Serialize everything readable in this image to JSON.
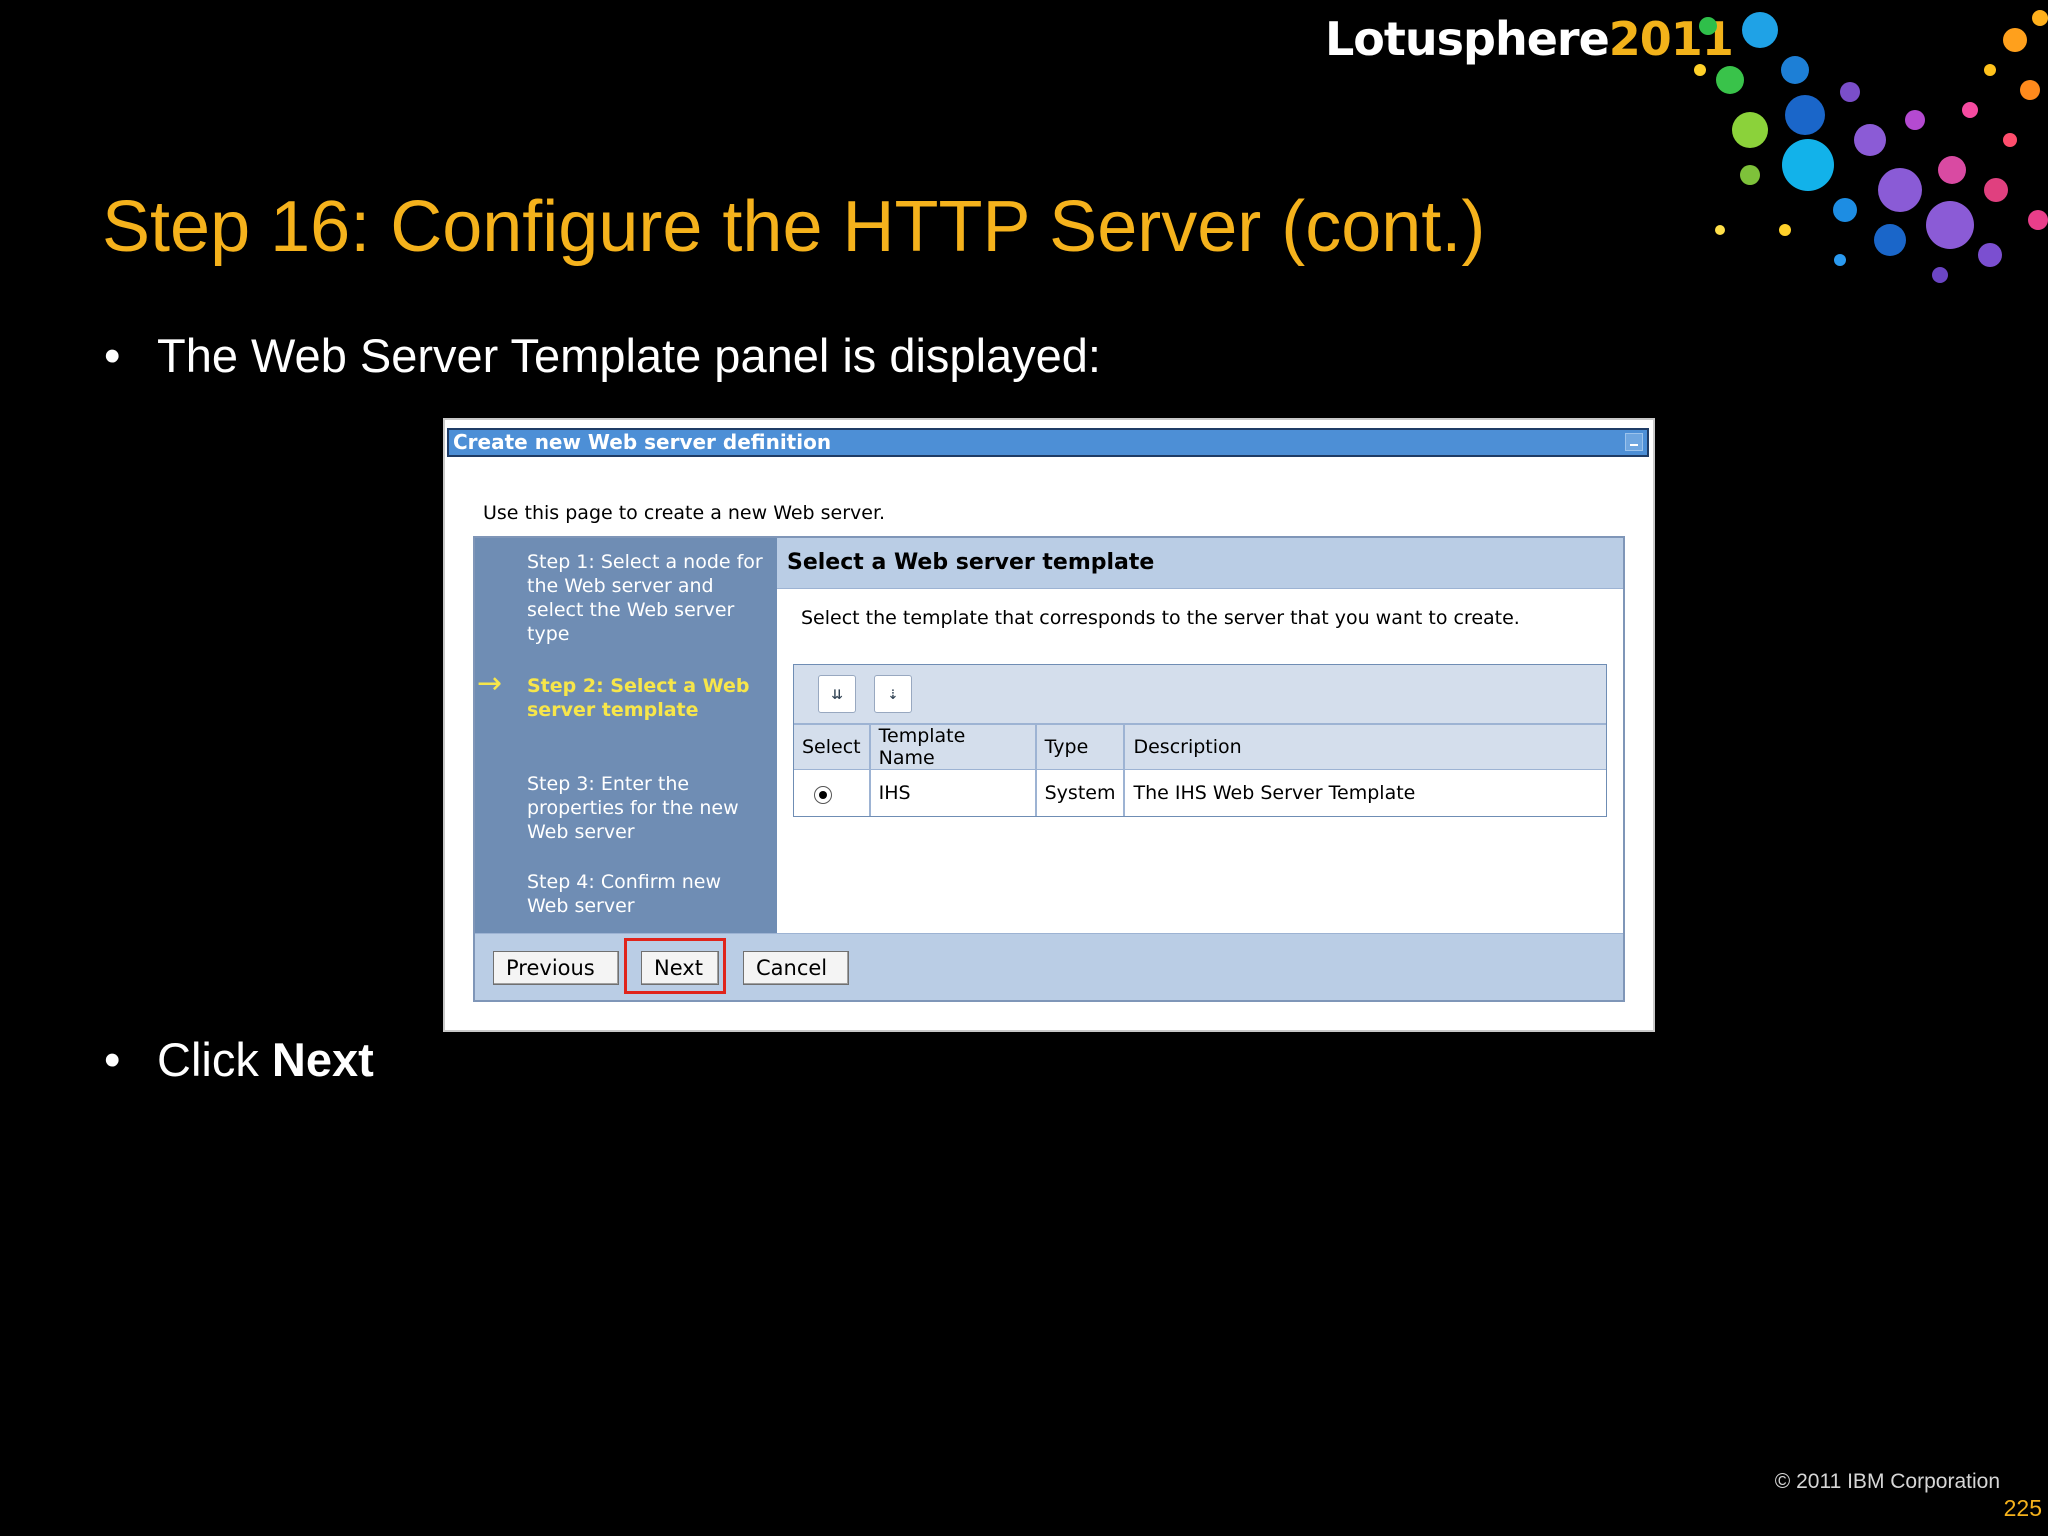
{
  "brand": {
    "name": "Lotusphere",
    "year": "2011"
  },
  "slide": {
    "title": "Step 16: Configure the HTTP Server (cont.)",
    "bullet1": "The Web Server Template panel is displayed:",
    "bullet2_prefix": "Click ",
    "bullet2_bold": "Next",
    "bullet_glyph": "•"
  },
  "dialog": {
    "title": "Create new Web server definition",
    "intro": "Use this page to create a new Web server.",
    "steps": [
      {
        "label": "Step 1: Select a node for the Web server and select the Web server type"
      },
      {
        "label": "Step 2: Select a Web server template"
      },
      {
        "label": "Step 3: Enter the properties for the new Web server"
      },
      {
        "label": "Step 4: Confirm new Web server"
      }
    ],
    "current_step_arrow": "→",
    "panel_title": "Select a Web server template",
    "panel_desc": "Select the template that corresponds to the server that you want to create.",
    "table": {
      "columns": [
        "Select",
        "Template Name",
        "Type",
        "Description"
      ],
      "rows": [
        {
          "template_name": "IHS",
          "type": "System",
          "description": "The IHS Web Server Template",
          "selected": true
        }
      ]
    },
    "buttons": {
      "previous": "Previous",
      "next": "Next",
      "cancel": "Cancel"
    }
  },
  "footer": {
    "copyright": "© 2011 IBM Corporation",
    "page_number": "225"
  },
  "colors": {
    "accent": "#f5b21c",
    "title_bar": "#4d8fd6",
    "steps_bg": "#6f8db4",
    "highlight": "#e0241b"
  }
}
